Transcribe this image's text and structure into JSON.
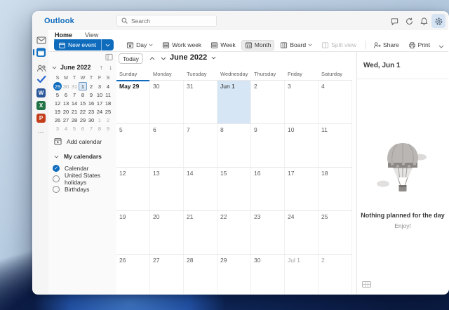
{
  "titlebar": {
    "brand": "Outlook",
    "search_placeholder": "Search"
  },
  "rail": {
    "items": [
      {
        "name": "mail"
      },
      {
        "name": "calendar",
        "active": true
      },
      {
        "name": "people"
      },
      {
        "name": "to-do"
      },
      {
        "name": "word",
        "letter": "W"
      },
      {
        "name": "excel",
        "letter": "X"
      },
      {
        "name": "powerpoint",
        "letter": "P"
      },
      {
        "name": "more-apps"
      }
    ]
  },
  "ribbon": {
    "tabs": [
      {
        "label": "Home",
        "active": true
      },
      {
        "label": "View",
        "active": false
      }
    ],
    "new_event_label": "New event",
    "commands": [
      {
        "label": "Day",
        "chevron": true
      },
      {
        "label": "Work week"
      },
      {
        "label": "Week"
      },
      {
        "label": "Month",
        "selected": true
      },
      {
        "label": "Board",
        "chevron": true
      },
      {
        "label": "Split view",
        "disabled": true
      },
      {
        "label": "Share"
      },
      {
        "label": "Print"
      }
    ]
  },
  "sidebar": {
    "mini_calendar": {
      "title": "June 2022",
      "day_letters": [
        "S",
        "M",
        "T",
        "W",
        "T",
        "F",
        "S"
      ],
      "weeks": [
        [
          {
            "d": "29",
            "sel": true
          },
          {
            "d": "30",
            "muted": true
          },
          {
            "d": "31",
            "muted": true
          },
          {
            "d": "1",
            "today": true
          },
          {
            "d": "2"
          },
          {
            "d": "3"
          },
          {
            "d": "4"
          }
        ],
        [
          {
            "d": "5"
          },
          {
            "d": "6"
          },
          {
            "d": "7"
          },
          {
            "d": "8"
          },
          {
            "d": "9"
          },
          {
            "d": "10"
          },
          {
            "d": "11"
          }
        ],
        [
          {
            "d": "12"
          },
          {
            "d": "13"
          },
          {
            "d": "14"
          },
          {
            "d": "15"
          },
          {
            "d": "16"
          },
          {
            "d": "17"
          },
          {
            "d": "18"
          }
        ],
        [
          {
            "d": "19"
          },
          {
            "d": "20"
          },
          {
            "d": "21"
          },
          {
            "d": "22"
          },
          {
            "d": "23"
          },
          {
            "d": "24"
          },
          {
            "d": "25"
          }
        ],
        [
          {
            "d": "26"
          },
          {
            "d": "27"
          },
          {
            "d": "28"
          },
          {
            "d": "29"
          },
          {
            "d": "30"
          },
          {
            "d": "1",
            "muted": true
          },
          {
            "d": "2",
            "muted": true
          }
        ],
        [
          {
            "d": "3",
            "muted": true
          },
          {
            "d": "4",
            "muted": true
          },
          {
            "d": "5",
            "muted": true
          },
          {
            "d": "6",
            "muted": true
          },
          {
            "d": "7",
            "muted": true
          },
          {
            "d": "8",
            "muted": true
          },
          {
            "d": "9",
            "muted": true
          }
        ]
      ]
    },
    "add_calendar_label": "Add calendar",
    "my_calendars_label": "My calendars",
    "calendars": [
      {
        "label": "Calendar",
        "checked": true
      },
      {
        "label": "United States holidays",
        "checked": false
      },
      {
        "label": "Birthdays",
        "checked": false
      }
    ]
  },
  "view_header": {
    "today_label": "Today",
    "period_label": "June 2022"
  },
  "month_grid": {
    "day_headers": [
      "Sunday",
      "Monday",
      "Tuesday",
      "Wednesday",
      "Thursday",
      "Friday",
      "Saturday"
    ],
    "weeks": [
      [
        {
          "d": "May 29",
          "selected": true
        },
        {
          "d": "30"
        },
        {
          "d": "31"
        },
        {
          "d": "Jun 1",
          "today": true
        },
        {
          "d": "2"
        },
        {
          "d": "3"
        },
        {
          "d": "4"
        }
      ],
      [
        {
          "d": "5"
        },
        {
          "d": "6"
        },
        {
          "d": "7"
        },
        {
          "d": "8"
        },
        {
          "d": "9"
        },
        {
          "d": "10"
        },
        {
          "d": "11"
        }
      ],
      [
        {
          "d": "12"
        },
        {
          "d": "13"
        },
        {
          "d": "14"
        },
        {
          "d": "15"
        },
        {
          "d": "16"
        },
        {
          "d": "17"
        },
        {
          "d": "18"
        }
      ],
      [
        {
          "d": "19"
        },
        {
          "d": "20"
        },
        {
          "d": "21"
        },
        {
          "d": "22"
        },
        {
          "d": "23"
        },
        {
          "d": "24"
        },
        {
          "d": "25"
        }
      ],
      [
        {
          "d": "26"
        },
        {
          "d": "27"
        },
        {
          "d": "28"
        },
        {
          "d": "29"
        },
        {
          "d": "30"
        },
        {
          "d": "Jul 1",
          "muted": true
        },
        {
          "d": "2",
          "muted": true
        }
      ]
    ]
  },
  "agenda": {
    "date_label": "Wed, Jun 1",
    "empty_title": "Nothing planned for the day",
    "empty_subtitle": "Enjoy!"
  },
  "icons": {
    "mini_prev": "↑",
    "mini_next": "↓",
    "more": "⋯",
    "check": "✓"
  },
  "colors": {
    "accent": "#0f6cbd",
    "today_fill": "#d7e6f5",
    "word": "#2b579a",
    "excel": "#217346",
    "powerpoint": "#c43e1c"
  }
}
